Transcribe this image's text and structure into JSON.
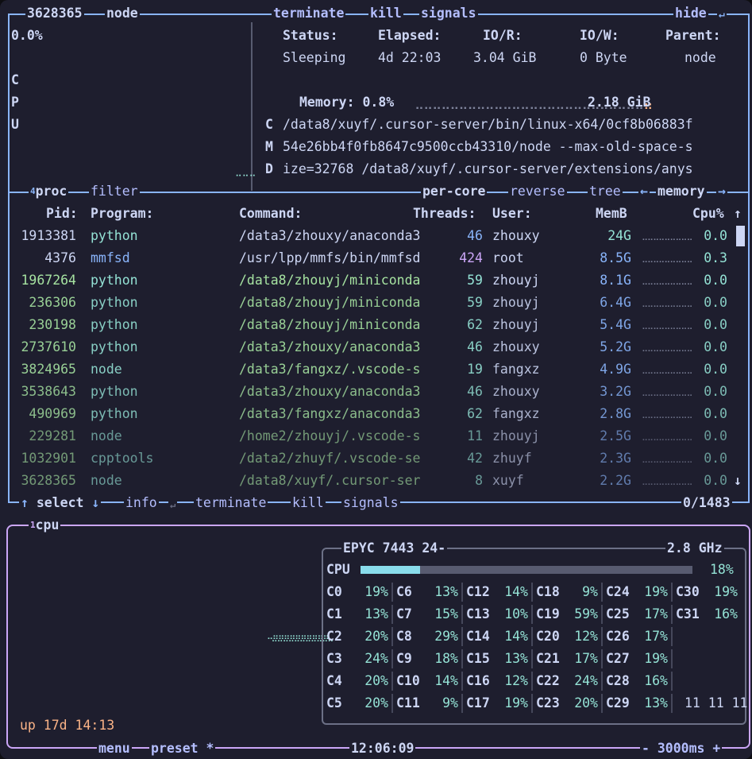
{
  "proc_detail": {
    "pid": "3628365",
    "name": "node",
    "actions": [
      "terminate",
      "kill",
      "signals"
    ],
    "hide": "hide",
    "cpu_percent": "0.0%",
    "cpu_vertical": [
      "C",
      "P",
      "U"
    ],
    "status_headers": [
      "Status:",
      "Elapsed:",
      "IO/R:",
      "IO/W:",
      "Parent:"
    ],
    "status_values": [
      "Sleeping",
      "4d 22:03",
      "3.04 GiB",
      "0 Byte",
      "node"
    ],
    "memory_label": "Memory: 0.8%",
    "memory_value": "2.18 GiB",
    "cmd_lines": [
      {
        "prefix": "C",
        "text": "/data8/xuyf/.cursor-server/bin/linux-x64/0cf8b06883f"
      },
      {
        "prefix": "M",
        "text": "54e26bb4f0fb8647c9500ccb43310/node --max-old-space-s"
      },
      {
        "prefix": "D",
        "text": "ize=32768 /data8/xuyf/.cursor-server/extensions/anys"
      }
    ]
  },
  "proc_list": {
    "title_num": "4",
    "title": "proc",
    "filter": "filter",
    "per_core": "per-core",
    "reverse": "reverse",
    "tree": "tree",
    "sort": "memory",
    "headers": {
      "pid": "Pid:",
      "program": "Program:",
      "command": "Command:",
      "threads": "Threads:",
      "user": "User:",
      "mem": "MemB",
      "cpu": "Cpu%"
    },
    "rows": [
      {
        "pid": "1913381",
        "program": "python",
        "command": "/data3/zhouxy/anaconda3",
        "threads": "46",
        "user": "zhouxy",
        "mem": "24G",
        "cpu": "0.0"
      },
      {
        "pid": "4376",
        "program": "mmfsd",
        "command": "/usr/lpp/mmfs/bin/mmfsd",
        "threads": "424",
        "user": "root",
        "mem": "8.5G",
        "cpu": "0.3"
      },
      {
        "pid": "1967264",
        "program": "python",
        "command": "/data8/zhouyj/miniconda",
        "threads": "59",
        "user": "zhouyj",
        "mem": "8.1G",
        "cpu": "0.0"
      },
      {
        "pid": "236306",
        "program": "python",
        "command": "/data8/zhouyj/miniconda",
        "threads": "59",
        "user": "zhouyj",
        "mem": "6.4G",
        "cpu": "0.0"
      },
      {
        "pid": "230198",
        "program": "python",
        "command": "/data8/zhouyj/miniconda",
        "threads": "62",
        "user": "zhouyj",
        "mem": "5.4G",
        "cpu": "0.0"
      },
      {
        "pid": "2737610",
        "program": "python",
        "command": "/data3/zhouxy/anaconda3",
        "threads": "46",
        "user": "zhouxy",
        "mem": "5.2G",
        "cpu": "0.0"
      },
      {
        "pid": "3824965",
        "program": "node",
        "command": "/data3/fangxz/.vscode-s",
        "threads": "19",
        "user": "fangxz",
        "mem": "4.9G",
        "cpu": "0.0"
      },
      {
        "pid": "3538643",
        "program": "python",
        "command": "/data3/zhouxy/anaconda3",
        "threads": "46",
        "user": "zhouxy",
        "mem": "3.2G",
        "cpu": "0.0"
      },
      {
        "pid": "490969",
        "program": "python",
        "command": "/data3/fangxz/anaconda3",
        "threads": "62",
        "user": "fangxz",
        "mem": "2.8G",
        "cpu": "0.0"
      },
      {
        "pid": "229281",
        "program": "node",
        "command": "/home2/zhouyj/.vscode-s",
        "threads": "11",
        "user": "zhouyj",
        "mem": "2.5G",
        "cpu": "0.0"
      },
      {
        "pid": "1032901",
        "program": "cpptools",
        "command": "/data2/zhuyf/.vscode-se",
        "threads": "42",
        "user": "zhuyf",
        "mem": "2.3G",
        "cpu": "0.0"
      },
      {
        "pid": "3628365",
        "program": "node",
        "command": "/data8/xuyf/.cursor-ser",
        "threads": "8",
        "user": "xuyf",
        "mem": "2.2G",
        "cpu": "0.0"
      }
    ],
    "footer": {
      "select": "select",
      "info": "info",
      "terminate": "terminate",
      "kill": "kill",
      "signals": "signals",
      "count": "0/1483"
    }
  },
  "cpu_panel": {
    "title_num": "1",
    "title": "cpu",
    "model": "EPYC 7443 24-",
    "freq": "2.8 GHz",
    "total_label": "CPU",
    "total_pct": "18%",
    "total_value": 0.18,
    "cores": [
      [
        "C0",
        "19%"
      ],
      [
        "C1",
        "13%"
      ],
      [
        "C2",
        "20%"
      ],
      [
        "C3",
        "24%"
      ],
      [
        "C4",
        "20%"
      ],
      [
        "C5",
        "20%"
      ],
      [
        "C6",
        "13%"
      ],
      [
        "C7",
        "15%"
      ],
      [
        "C8",
        "29%"
      ],
      [
        "C9",
        "18%"
      ],
      [
        "C10",
        "14%"
      ],
      [
        "C11",
        "9%"
      ],
      [
        "C12",
        "14%"
      ],
      [
        "C13",
        "10%"
      ],
      [
        "C14",
        "14%"
      ],
      [
        "C15",
        "13%"
      ],
      [
        "C16",
        "12%"
      ],
      [
        "C17",
        "19%"
      ],
      [
        "C18",
        "9%"
      ],
      [
        "C19",
        "59%"
      ],
      [
        "C20",
        "12%"
      ],
      [
        "C21",
        "17%"
      ],
      [
        "C22",
        "24%"
      ],
      [
        "C23",
        "20%"
      ],
      [
        "C24",
        "19%"
      ],
      [
        "C25",
        "17%"
      ],
      [
        "C26",
        "17%"
      ],
      [
        "C27",
        "19%"
      ],
      [
        "C28",
        "16%"
      ],
      [
        "C29",
        "13%"
      ],
      [
        "C30",
        "19%"
      ],
      [
        "C31",
        "16%"
      ]
    ],
    "load_avg": "11 11 11",
    "uptime": "up 17d 14:13",
    "menu": "menu",
    "preset": "preset *",
    "clock": "12:06:09",
    "interval": "- 3000ms +"
  }
}
